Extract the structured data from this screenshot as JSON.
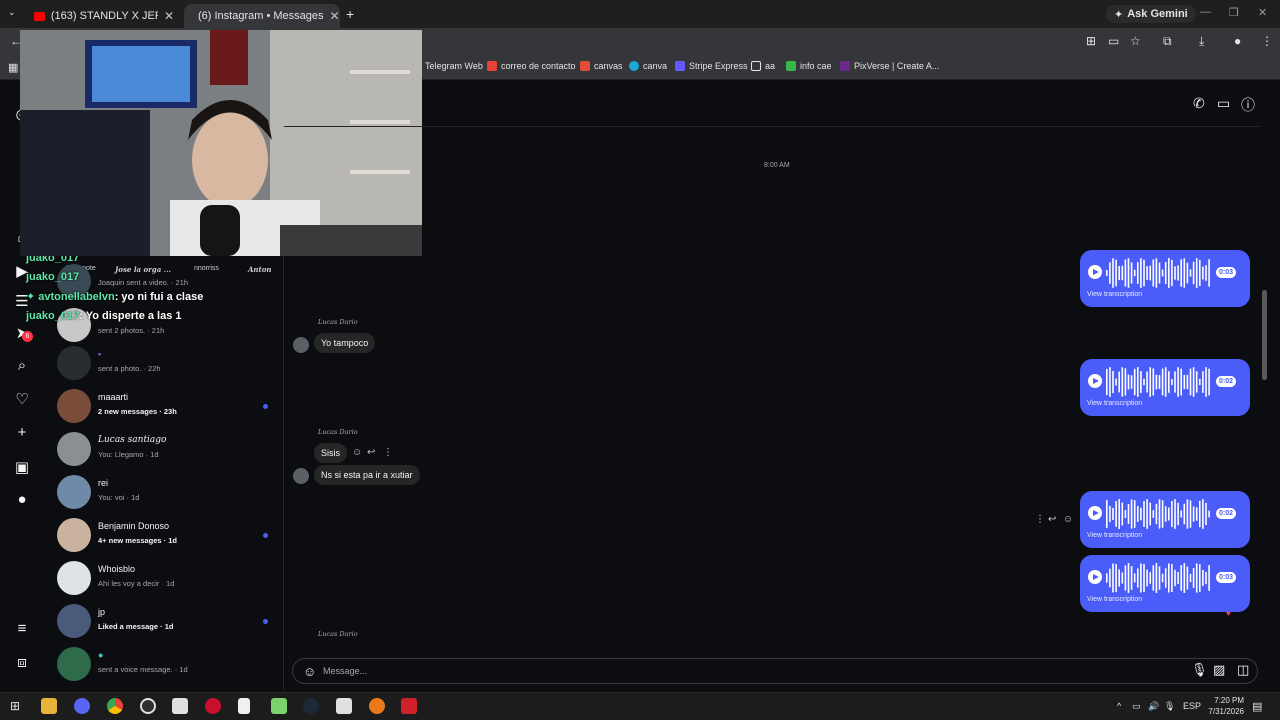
{
  "browser": {
    "tabs": [
      {
        "title": "(163) STANDLY X JERE KLEIN X",
        "active": false
      },
      {
        "title": "(6) Instagram • Messages",
        "active": true
      }
    ],
    "ask_gemini": "Ask Gemini",
    "bookmarks": [
      "Telegram Web",
      "correo de contacto",
      "canvas",
      "canva",
      "Stripe Express",
      "aa",
      "info cae",
      "PixVerse | Create A..."
    ]
  },
  "rail": {
    "notification_count": "6"
  },
  "stories": [
    "Your note",
    "Jose la orga ...",
    "nnorriss",
    "Anton"
  ],
  "stream_chat": [
    {
      "user": "juako_017",
      "text": ""
    },
    {
      "user": "juako_017",
      "text": ""
    },
    {
      "user": "avtonellabelvn",
      "text": ": yo ni fui a clase"
    },
    {
      "user": "juako_017",
      "text": ": Yo disperte a las 1"
    }
  ],
  "conversations": [
    {
      "name": "",
      "preview": "Joaquin sent a video. · 21h",
      "unread": false
    },
    {
      "name": "",
      "preview": "sent 2 photos. · 21h",
      "unread": false
    },
    {
      "name": "",
      "preview": "sent a photo. · 22h",
      "unread": false
    },
    {
      "name": "maaarti",
      "preview": "2 new messages · 23h",
      "unread": true
    },
    {
      "name": "Lucas santiago",
      "preview": "You: Llegamo · 1d",
      "unread": false
    },
    {
      "name": "rei",
      "preview": "You: voi · 1d",
      "unread": false
    },
    {
      "name": "Benjamin Donoso",
      "preview": "4+ new messages · 1d",
      "unread": true
    },
    {
      "name": "Whoisblo",
      "preview": "Ahí les voy a decir · 1d",
      "unread": false
    },
    {
      "name": "jp",
      "preview": "Liked a message · 1d",
      "unread": true
    },
    {
      "name": "",
      "preview": "sent a voice message. · 1d",
      "unread": false
    }
  ],
  "thread": {
    "timestamp": "8:00 AM",
    "sender_name": "Lucas Dario",
    "messages": [
      {
        "text": "Yo tampoco"
      },
      {
        "text": "Sisis"
      },
      {
        "text": "Ns si esta pa ir a xutiar"
      }
    ],
    "voice_notes": [
      {
        "duration": "0:03",
        "link": "View transcription"
      },
      {
        "duration": "0:02",
        "link": "View transcription"
      },
      {
        "duration": "0:02",
        "link": "View transcription"
      },
      {
        "duration": "0:03",
        "link": "View transcription"
      }
    ]
  },
  "composer": {
    "placeholder": "Message..."
  },
  "taskbar": {
    "time": "7:20 PM",
    "date": "7/31/2026",
    "lang": "ESP"
  },
  "colors": {
    "accent": "#4a5df9",
    "background": "#0b0d10",
    "bubble": "#262626"
  }
}
